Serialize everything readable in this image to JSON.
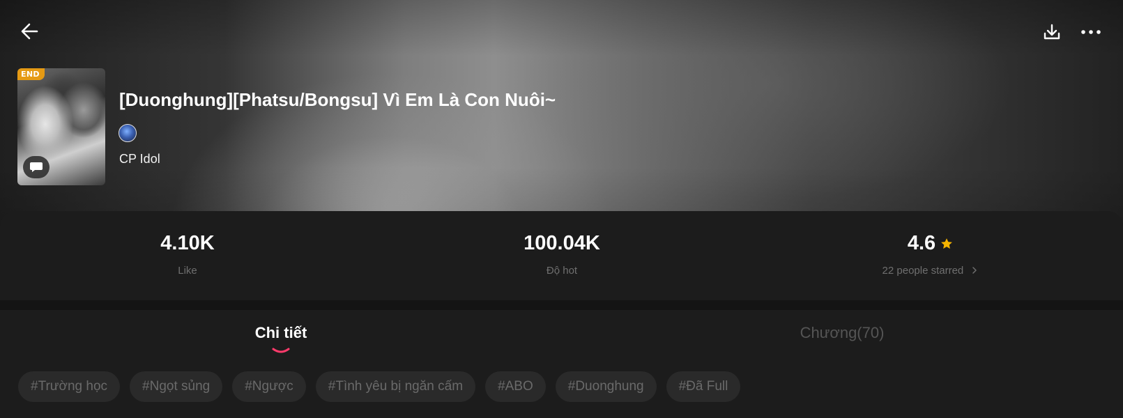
{
  "header": {
    "back_icon": "arrow-left-icon",
    "download_icon": "download-icon",
    "more_icon": "more-horizontal-icon"
  },
  "book": {
    "status_badge": "END",
    "title": "[Duonghung][Phatsu/Bongsu] Vì Em Là Con Nuôi~",
    "category": "CP Idol",
    "cover_icon": "chat-bubble-icon"
  },
  "stats": {
    "likes": {
      "value": "4.10K",
      "label": "Like"
    },
    "hot": {
      "value": "100.04K",
      "label": "Độ hot"
    },
    "rating": {
      "value": "4.6",
      "label": "22 people starred",
      "star_color": "#f5b400"
    }
  },
  "tabs": [
    {
      "label": "Chi tiết",
      "active": true
    },
    {
      "label": "Chương(70)",
      "active": false
    }
  ],
  "tags": [
    "#Trường học",
    "#Ngọt sủng",
    "#Ngược",
    "#Tình yêu bị ngăn cấm",
    "#ABO",
    "#Duonghung",
    "#Đã Full"
  ],
  "colors": {
    "accent": "#ff3b6b",
    "badge": "#e59a14",
    "panel_bg": "#1c1c1c",
    "tag_bg": "#2a2a2a"
  }
}
